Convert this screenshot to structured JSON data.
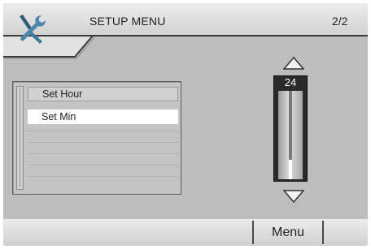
{
  "header": {
    "title": "SETUP MENU",
    "page_indicator": "2/2",
    "icon": "tools-icon"
  },
  "list": {
    "items": [
      {
        "label": "Set Hour",
        "state": "normal"
      },
      {
        "label": "Set Min",
        "state": "selected"
      }
    ]
  },
  "slider": {
    "value": "24",
    "level_fraction": 0.22,
    "up_icon": "triangle-up-icon",
    "down_icon": "triangle-down-icon"
  },
  "footer": {
    "menu_label": "Menu"
  },
  "colors": {
    "background": "#bdbdbd",
    "selected_row": "#ffffff",
    "slider_body": "#2a2a2a"
  }
}
